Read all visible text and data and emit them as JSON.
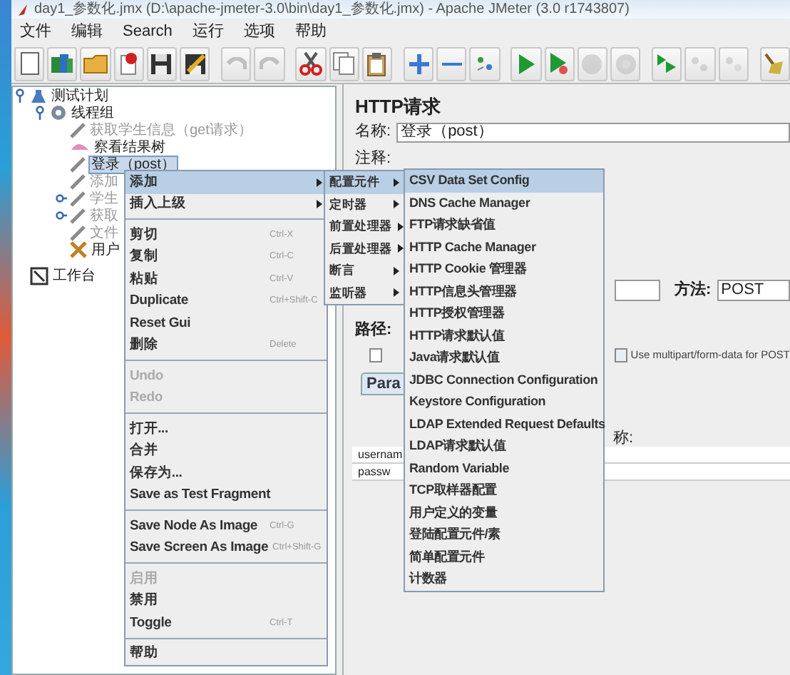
{
  "window": {
    "title": "day1_参数化.jmx (D:\\apache-jmeter-3.0\\bin\\day1_参数化.jmx) - Apache JMeter (3.0 r1743807)"
  },
  "menu_bar": [
    "文件",
    "编辑",
    "Search",
    "运行",
    "选项",
    "帮助"
  ],
  "toolbar": [
    {
      "kind": "new",
      "disabled": false
    },
    {
      "kind": "templates",
      "disabled": false
    },
    {
      "kind": "open",
      "disabled": false
    },
    {
      "kind": "close",
      "disabled": false
    },
    {
      "kind": "save",
      "disabled": false
    },
    {
      "kind": "save_as",
      "disabled": false
    },
    {
      "kind": "sep"
    },
    {
      "kind": "undo",
      "disabled": true
    },
    {
      "kind": "redo",
      "disabled": true
    },
    {
      "kind": "sep"
    },
    {
      "kind": "cut",
      "disabled": false
    },
    {
      "kind": "copy",
      "disabled": false
    },
    {
      "kind": "paste",
      "disabled": false
    },
    {
      "kind": "sep"
    },
    {
      "kind": "expand",
      "disabled": false
    },
    {
      "kind": "collapse",
      "disabled": false
    },
    {
      "kind": "toggle",
      "disabled": false
    },
    {
      "kind": "sep"
    },
    {
      "kind": "start",
      "disabled": false
    },
    {
      "kind": "start_no_pause",
      "disabled": false
    },
    {
      "kind": "stop",
      "disabled": true
    },
    {
      "kind": "shutdown",
      "disabled": true
    },
    {
      "kind": "sep"
    },
    {
      "kind": "remote_start",
      "disabled": false
    },
    {
      "kind": "remote_stop",
      "disabled": true
    },
    {
      "kind": "remote_exit",
      "disabled": true
    },
    {
      "kind": "sep"
    },
    {
      "kind": "clear",
      "disabled": false
    }
  ],
  "tree": [
    {
      "label": "测试计划",
      "kind": "plan",
      "expanded": true,
      "disabled": false,
      "selected": false,
      "children": [
        {
          "label": "线程组",
          "kind": "group",
          "expanded": true,
          "disabled": false,
          "selected": false,
          "children": [
            {
              "label": "获取学生信息（get请求）",
              "kind": "sampler",
              "disabled": true,
              "selected": false
            },
            {
              "label": "察看结果树",
              "kind": "listener",
              "disabled": false,
              "selected": false
            },
            {
              "label": "登录（post）",
              "kind": "sampler",
              "disabled": false,
              "selected": true
            },
            {
              "label": "添加",
              "kind": "sampler",
              "disabled": true,
              "selected": false
            },
            {
              "label": "学生",
              "kind": "sampler",
              "disabled": true,
              "selected": false,
              "expanded": false
            },
            {
              "label": "获取",
              "kind": "sampler",
              "disabled": true,
              "selected": false,
              "expanded": false
            },
            {
              "label": "文件",
              "kind": "sampler",
              "disabled": true,
              "selected": false
            },
            {
              "label": "用户",
              "kind": "tool",
              "disabled": false,
              "selected": false
            }
          ]
        }
      ]
    },
    {
      "label": "工作台",
      "kind": "workbench",
      "disabled": false,
      "selected": false
    }
  ],
  "panel": {
    "title": "HTTP请求",
    "name_label": "名称:",
    "name_value": "登录（post）",
    "comment_label": "注释:",
    "method_label": "方法:",
    "method_value": "POST",
    "path_label": "路径:",
    "option_checked": false,
    "multipart": {
      "label": "Use multipart/form-data for POST",
      "checked": false
    },
    "tab": "Para",
    "column_label": "称:",
    "params": [
      "usernam",
      "passw"
    ]
  },
  "context_menu": [
    {
      "kind": "submenu",
      "label": "添加",
      "selected": true
    },
    {
      "kind": "submenu",
      "label": "插入上级",
      "selected": false
    },
    {
      "kind": "separator"
    },
    {
      "kind": "item",
      "label": "剪切",
      "shortcut": "Ctrl-X",
      "disabled": false,
      "selected": false
    },
    {
      "kind": "item",
      "label": "复制",
      "shortcut": "Ctrl-C",
      "disabled": false,
      "selected": false
    },
    {
      "kind": "item",
      "label": "粘贴",
      "shortcut": "Ctrl-V",
      "disabled": false,
      "selected": false
    },
    {
      "kind": "item",
      "label": "Duplicate",
      "shortcut": "Ctrl+Shift-C",
      "disabled": false,
      "selected": false
    },
    {
      "kind": "item",
      "label": "Reset Gui",
      "disabled": false,
      "selected": false
    },
    {
      "kind": "item",
      "label": "删除",
      "shortcut": "Delete",
      "disabled": false,
      "selected": false
    },
    {
      "kind": "separator"
    },
    {
      "kind": "item",
      "label": "Undo",
      "disabled": true,
      "selected": false
    },
    {
      "kind": "item",
      "label": "Redo",
      "disabled": true,
      "selected": false
    },
    {
      "kind": "separator"
    },
    {
      "kind": "item",
      "label": "打开...",
      "disabled": false,
      "selected": false
    },
    {
      "kind": "item",
      "label": "合并",
      "disabled": false,
      "selected": false
    },
    {
      "kind": "item",
      "label": "保存为...",
      "disabled": false,
      "selected": false
    },
    {
      "kind": "item",
      "label": "Save as Test Fragment",
      "disabled": false,
      "selected": false
    },
    {
      "kind": "separator"
    },
    {
      "kind": "item",
      "label": "Save Node As Image",
      "shortcut": "Ctrl-G",
      "disabled": false,
      "selected": false
    },
    {
      "kind": "item",
      "label": "Save Screen As Image",
      "shortcut": "Ctrl+Shift-G",
      "disabled": false,
      "selected": false
    },
    {
      "kind": "separator"
    },
    {
      "kind": "item",
      "label": "启用",
      "disabled": true,
      "selected": false
    },
    {
      "kind": "item",
      "label": "禁用",
      "disabled": false,
      "selected": false
    },
    {
      "kind": "item",
      "label": "Toggle",
      "shortcut": "Ctrl-T",
      "disabled": false,
      "selected": false
    },
    {
      "kind": "separator"
    },
    {
      "kind": "item",
      "label": "帮助",
      "disabled": false,
      "selected": false
    }
  ],
  "add_submenu": [
    {
      "label": "配置元件",
      "selected": true
    },
    {
      "label": "定时器",
      "selected": false
    },
    {
      "label": "前置处理器",
      "selected": false
    },
    {
      "label": "后置处理器",
      "selected": false
    },
    {
      "label": "断言",
      "selected": false
    },
    {
      "label": "监听器",
      "selected": false
    }
  ],
  "config_submenu": [
    {
      "label": "CSV Data Set Config",
      "selected": true
    },
    {
      "label": "DNS Cache Manager",
      "selected": false
    },
    {
      "label": "FTP请求缺省值",
      "selected": false
    },
    {
      "label": "HTTP Cache Manager",
      "selected": false
    },
    {
      "label": "HTTP Cookie 管理器",
      "selected": false
    },
    {
      "label": "HTTP信息头管理器",
      "selected": false
    },
    {
      "label": "HTTP授权管理器",
      "selected": false
    },
    {
      "label": "HTTP请求默认值",
      "selected": false
    },
    {
      "label": "Java请求默认值",
      "selected": false
    },
    {
      "label": "JDBC Connection Configuration",
      "selected": false
    },
    {
      "label": "Keystore Configuration",
      "selected": false
    },
    {
      "label": "LDAP Extended Request Defaults",
      "selected": false
    },
    {
      "label": "LDAP请求默认值",
      "selected": false
    },
    {
      "label": "Random Variable",
      "selected": false
    },
    {
      "label": "TCP取样器配置",
      "selected": false
    },
    {
      "label": "用户定义的变量",
      "selected": false
    },
    {
      "label": "登陆配置元件/素",
      "selected": false
    },
    {
      "label": "简单配置元件",
      "selected": false
    },
    {
      "label": "计数器",
      "selected": false
    }
  ]
}
